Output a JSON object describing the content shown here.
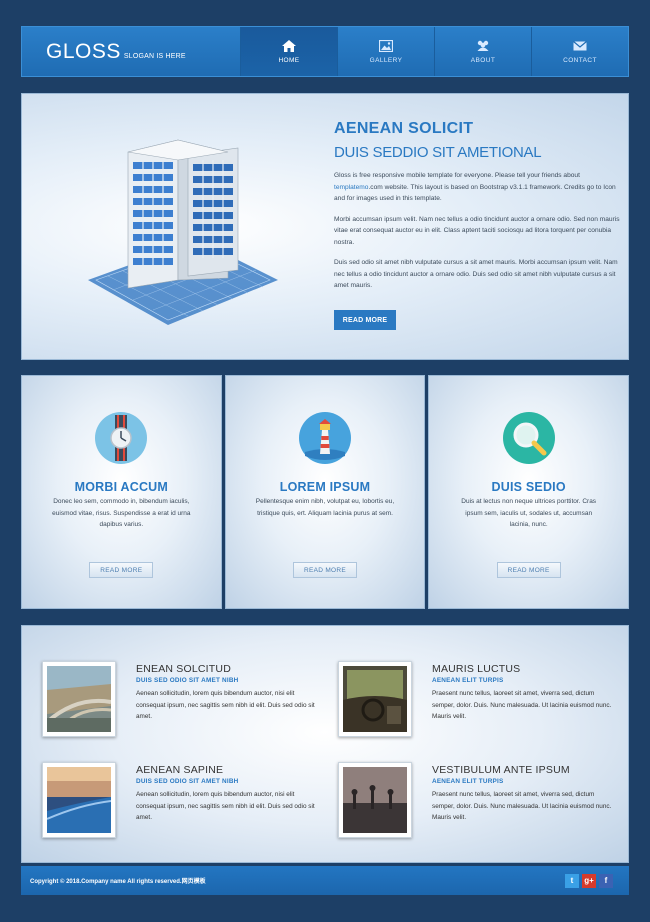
{
  "header": {
    "logo": "GLOSS",
    "slogan": "SLOGAN IS HERE",
    "nav": [
      {
        "label": "HOME",
        "icon": "home-icon",
        "active": true
      },
      {
        "label": "GALLERY",
        "icon": "image-icon",
        "active": false
      },
      {
        "label": "ABOUT",
        "icon": "users-icon",
        "active": false
      },
      {
        "label": "CONTACT",
        "icon": "envelope-icon",
        "active": false
      }
    ]
  },
  "hero": {
    "title": "AENEAN SOLICIT",
    "subtitle": "DUIS SEDDIO SIT AMETIONAL",
    "p1_before": "Gloss is free responsive mobile template for everyone. Please tell your friends about ",
    "p1_link": "templatemo",
    "p1_after": ".com website. This layout is based on Bootstrap v3.1.1 framework. Credits go to Icon and for images used in this template.",
    "p2": "Morbi accumsan ipsum velit. Nam nec tellus a odio tincidunt auctor a ornare odio. Sed non mauris vitae erat consequat auctor eu in elit. Class aptent taciti sociosqu ad litora torquent per conubia nostra.",
    "p3": "Duis sed odio sit amet nibh vulputate cursus a sit amet mauris. Morbi accumsan ipsum velit. Nam nec tellus a odio tincidunt auctor a ornare odio. Duis sed odio sit amet nibh vulputate cursus a sit amet mauris.",
    "button": "READ MORE"
  },
  "features": [
    {
      "title": "MORBI ACCUM",
      "desc": "Donec leo sem, commodo in, bibendum iaculis, euismod vitae, risus. Suspendisse a erat id urna dapibus varius.",
      "button": "READ MORE",
      "icon": "watch-icon"
    },
    {
      "title": "LOREM IPSUM",
      "desc": "Pellentesque enim nibh, volutpat eu, lobortis eu, tristique quis, ert. Aliquam lacinia purus at sem.",
      "button": "READ MORE",
      "icon": "lighthouse-icon"
    },
    {
      "title": "DUIS SEDIO",
      "desc": "Duis at lectus non neque ultrices porttitor. Cras ipsum sem, iaculis ut, sodales ut, accumsan lacinia, nunc.",
      "button": "READ MORE",
      "icon": "search-icon"
    }
  ],
  "news": [
    {
      "title": "ENEAN SOLCITUD",
      "sub": "DUIS SED ODIO SIT AMET NIBH",
      "desc": "Aenean sollicitudin, lorem quis bibendum auctor, nisi elit consequat ipsum, nec sagittis sem nibh id elit. Duis sed odio sit amet."
    },
    {
      "title": "MAURIS LUCTUS",
      "sub": "AENEAN ELIT TURPIS",
      "desc": "Praesent nunc tellus, laoreet sit amet, viverra sed, dictum semper, dolor. Duis. Nunc malesuada. Ut lacinia euismod nunc. Mauris velit."
    },
    {
      "title": "AENEAN SAPINE",
      "sub": "DUIS SED ODIO SIT AMET NIBH",
      "desc": "Aenean sollicitudin, lorem quis bibendum auctor, nisi elit consequat ipsum, nec sagittis sem nibh id elit. Duis sed odio sit amet."
    },
    {
      "title": "VESTIBULUM ANTE IPSUM",
      "sub": "AENEAN ELIT TURPIS",
      "desc": "Praesent nunc tellus, laoreet sit amet, viverra sed, dictum semper, dolor. Duis. Nunc malesuada. Ut lacinia euismod nunc. Mauris velit."
    }
  ],
  "footer": {
    "copyright": "Copyright © 2018.Company name All rights reserved.网页模板",
    "social": [
      {
        "icon": "twitter-icon",
        "glyph": "t",
        "color": "#3aa0e6"
      },
      {
        "icon": "google-plus-icon",
        "glyph": "g+",
        "color": "#d63a2b"
      },
      {
        "icon": "facebook-icon",
        "glyph": "f",
        "color": "#3b62b3"
      }
    ]
  }
}
